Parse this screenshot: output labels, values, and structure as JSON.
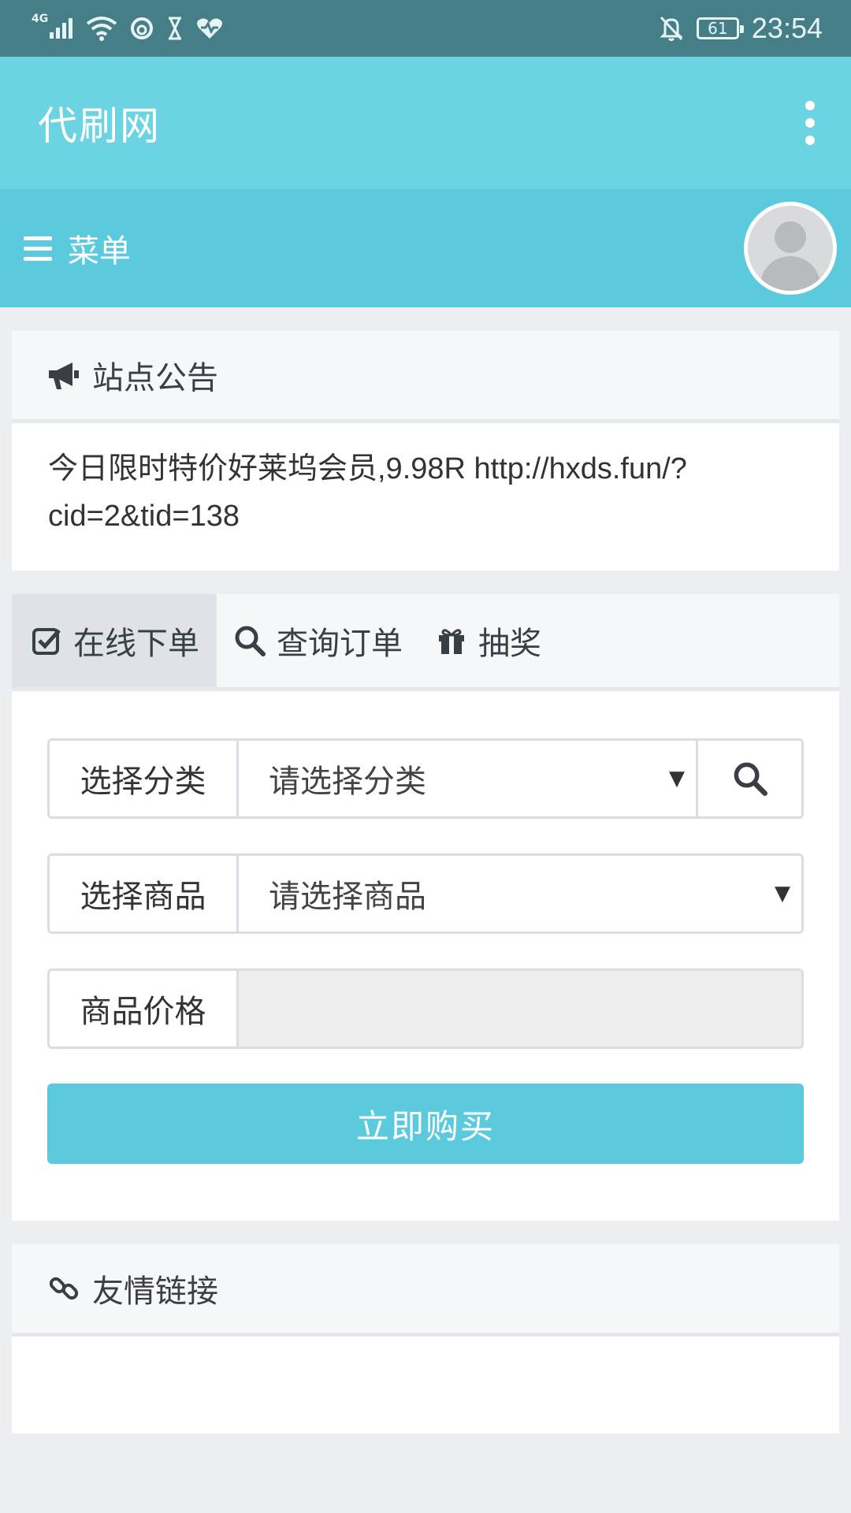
{
  "status_bar": {
    "network": "4G",
    "time": "23:54",
    "battery": "61"
  },
  "app_bar": {
    "title": "代刷网"
  },
  "menu_bar": {
    "label": "菜单"
  },
  "notice": {
    "title": "站点公告",
    "text": "今日限时特价好莱坞会员,9.98R http://hxds.fun/?cid=2&tid=138"
  },
  "order": {
    "tabs": [
      {
        "label": "在线下单",
        "icon": "check-square-icon",
        "active": true
      },
      {
        "label": "查询订单",
        "icon": "search-icon",
        "active": false
      },
      {
        "label": "抽奖",
        "icon": "gift-icon",
        "active": false
      }
    ],
    "category": {
      "label": "选择分类",
      "value": "请选择分类"
    },
    "product": {
      "label": "选择商品",
      "value": "请选择商品"
    },
    "price": {
      "label": "商品价格",
      "value": ""
    },
    "buy_label": "立即购买"
  },
  "links": {
    "title": "友情链接"
  },
  "colors": {
    "status_bar": "#467e88",
    "app_bar": "#6bd3e1",
    "menu_bar": "#5bcadd",
    "accent": "#5bcadd"
  }
}
